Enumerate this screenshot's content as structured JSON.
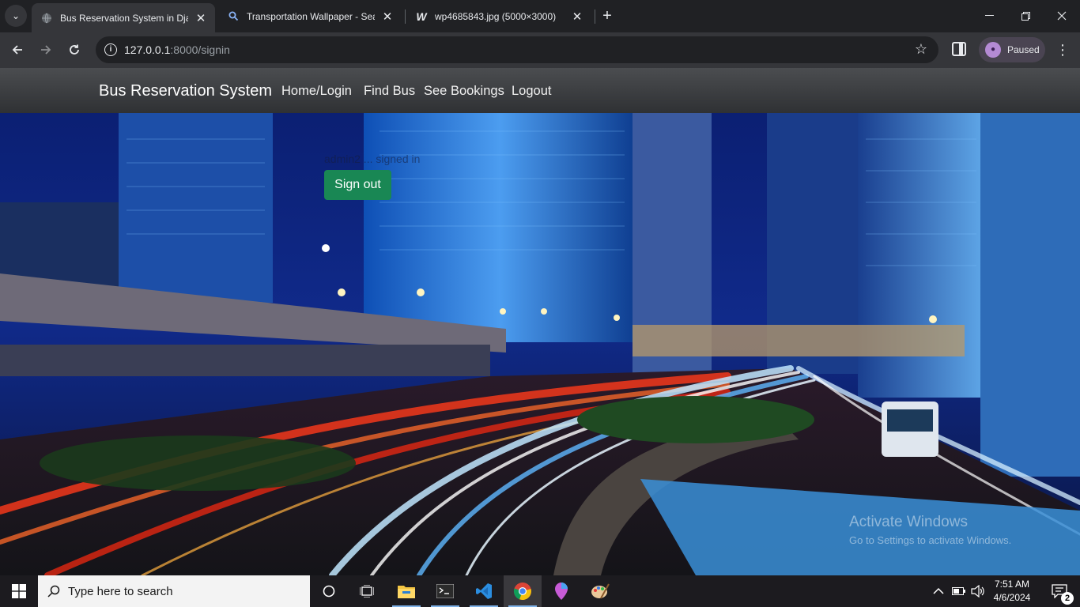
{
  "browser": {
    "tabs": [
      {
        "title": "Bus Reservation System in Djang",
        "icon": "globe-icon",
        "active": true
      },
      {
        "title": "Transportation Wallpaper - Sear",
        "icon": "search-icon",
        "active": false
      },
      {
        "title": "wp4685843.jpg (5000×3000)",
        "icon": "w-logo-icon",
        "active": false
      }
    ],
    "url_host": "127.0.0.1",
    "url_rest": ":8000/signin",
    "profile_status": "Paused"
  },
  "page": {
    "brand": "Bus Reservation System",
    "nav": [
      "Home/Login",
      "Find Bus",
      "See Bookings",
      "Logout"
    ],
    "signed_in_text": "admin2 ... signed in",
    "signout_label": "Sign out",
    "watermark_title": "Activate Windows",
    "watermark_sub": "Go to Settings to activate Windows."
  },
  "taskbar": {
    "search_placeholder": "Type here to search",
    "time": "7:51 AM",
    "date": "4/6/2024",
    "notification_count": "2",
    "pinned": [
      "cortana-icon",
      "task-view-icon",
      "file-explorer-icon",
      "terminal-icon",
      "vscode-icon",
      "chrome-icon",
      "maps-icon",
      "paint-icon"
    ]
  },
  "colors": {
    "signout_bg": "#198754",
    "navbar_bg": "#3d3f42",
    "chrome_dark": "#202124"
  }
}
